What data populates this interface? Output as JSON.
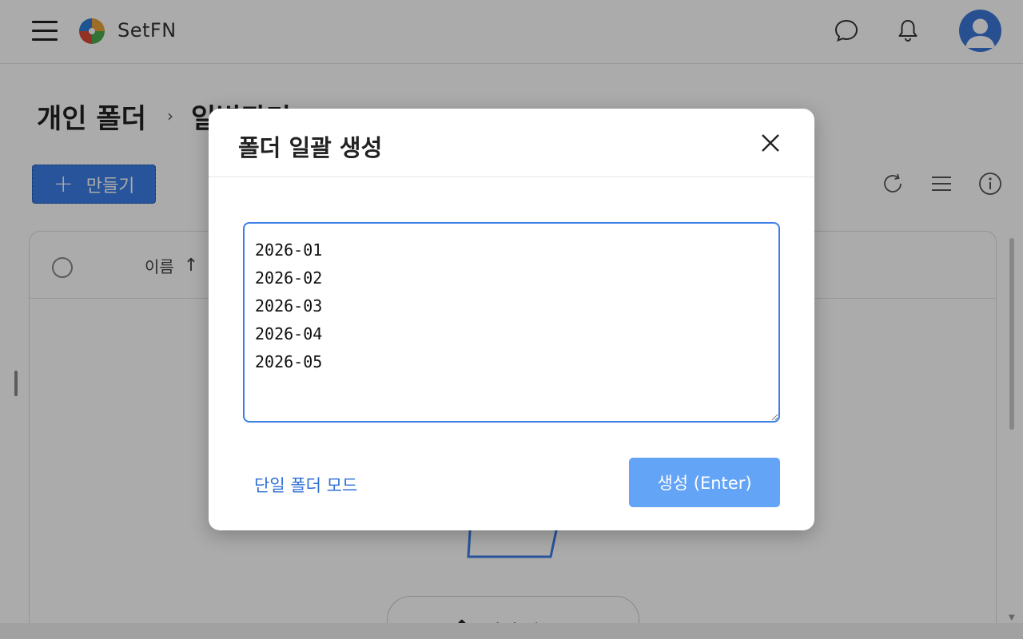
{
  "header": {
    "brand": "SetFN",
    "menu_icon": "hamburger-icon",
    "logo_icon": "puzzle-logo-icon",
    "chat_icon": "chat-bubble-icon",
    "bell_icon": "bell-icon",
    "avatar_icon": "user-avatar-icon"
  },
  "breadcrumb": {
    "items": [
      "개인 폴더",
      "일별관리"
    ],
    "separator": "›"
  },
  "toolbar": {
    "create_label": "만들기",
    "create_icon": "plus-icon",
    "refresh_icon": "refresh-icon",
    "list_icon": "list-view-icon",
    "info_icon": "info-icon"
  },
  "file_list": {
    "column_name": "이름",
    "sort_icon": "arrow-up-icon",
    "upload_label": "파일 업로드",
    "upload_icon": "upload-icon"
  },
  "modal": {
    "title": "폴더 일괄 생성",
    "close_icon": "close-icon",
    "textarea_value": "2026-01\n2026-02\n2026-03\n2026-04\n2026-05",
    "single_mode_label": "단일 폴더 모드",
    "submit_label": "생성 (Enter)"
  },
  "colors": {
    "accent": "#3b7ee6",
    "submit_button": "#63a4f7",
    "link": "#2f6fd6",
    "avatar_bg": "#3d78d8",
    "logo": [
      "#e8a33a",
      "#2f7ed8",
      "#4caa4f",
      "#d84a3a"
    ]
  }
}
